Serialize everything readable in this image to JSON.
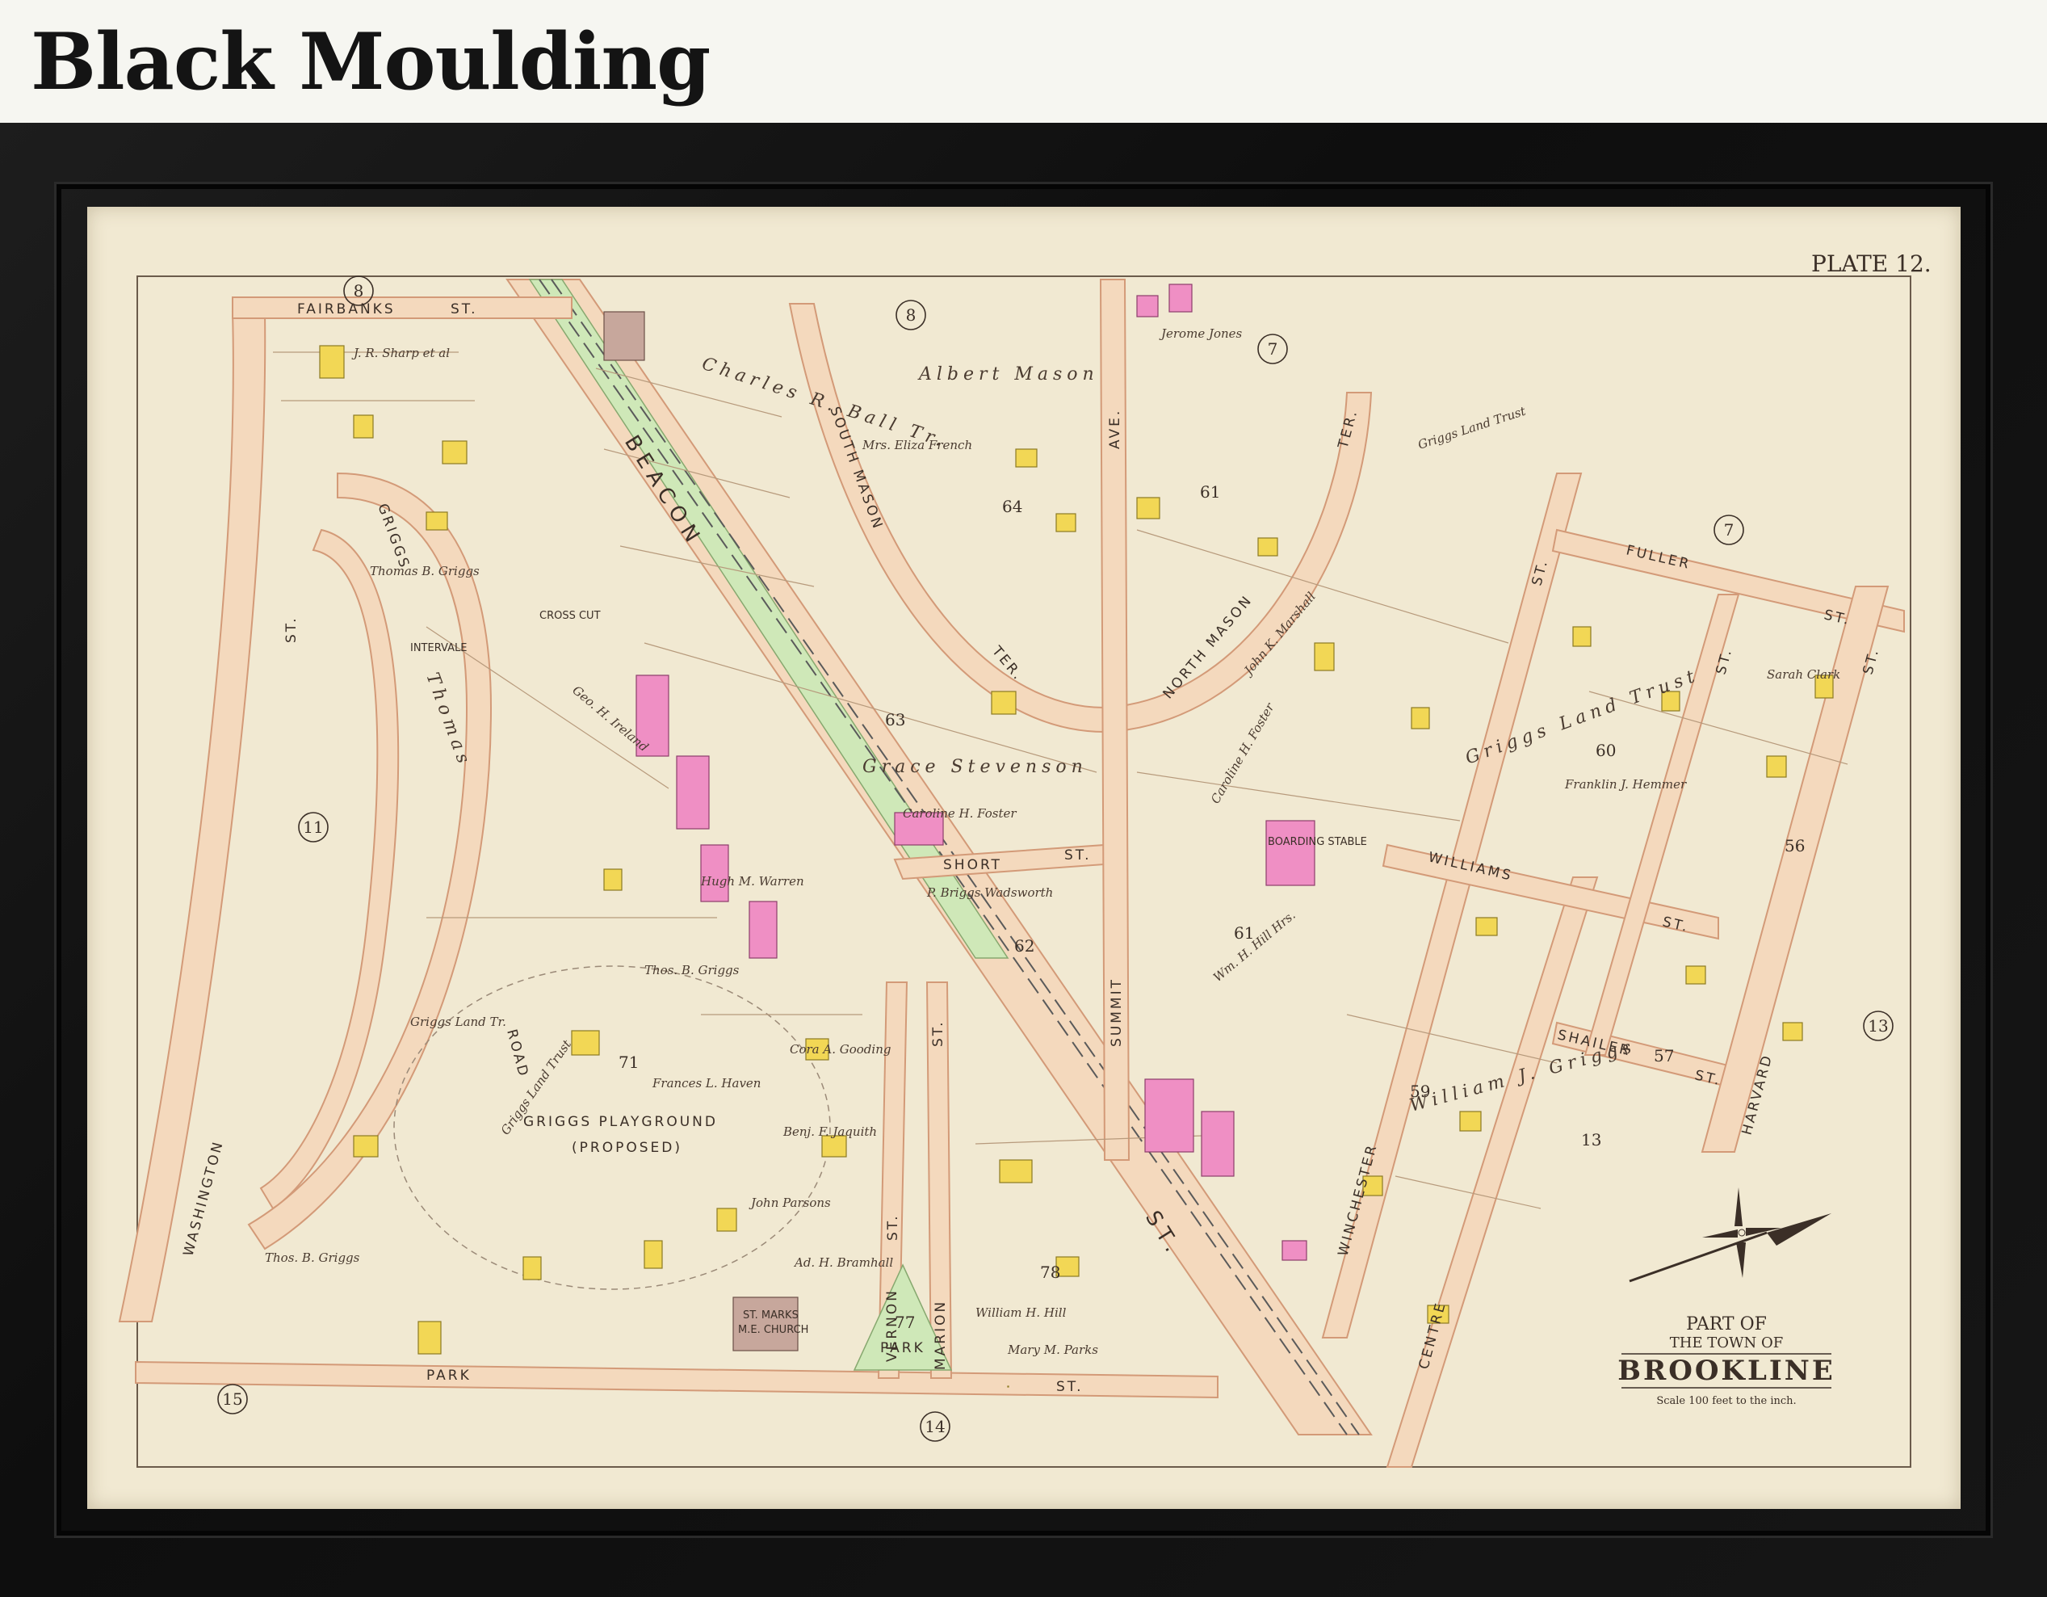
{
  "heading": "Black Moulding",
  "map": {
    "plate": "PLATE 12.",
    "title_line1": "PART OF",
    "title_line2": "THE TOWN OF",
    "title_line3": "BROOKLINE",
    "scale": "Scale 100 feet to the inch.",
    "ward_numbers": [
      "8",
      "8",
      "7",
      "7",
      "11",
      "15",
      "14",
      "13",
      "13"
    ],
    "streets": {
      "fairbanks": "FAIRBANKS",
      "st": "ST.",
      "beacon": "BEACON",
      "griggs": "GRIGGS",
      "road": "ROAD",
      "intervale": "INTERVALE",
      "cross_cut": "CROSS CUT",
      "washington": "WASHINGTON",
      "park": "PARK",
      "south_mason": "SOUTH MASON",
      "ter": "TER.",
      "north_mason": "NORTH MASON",
      "ave": "AVE.",
      "summit": "SUMMIT",
      "short": "SHORT",
      "fuller": "FULLER",
      "williams": "WILLIAMS",
      "shailer": "SHAILER",
      "harvard": "HARVARD",
      "winchester": "WINCHESTER",
      "centre": "CENTRE",
      "vernon": "VERNON",
      "marion": "MARION"
    },
    "places": {
      "playground": "GRIGGS PLAYGROUND",
      "proposed": "(PROPOSED)",
      "church_line1": "ST. MARKS",
      "church_line2": "M.E. CHURCH",
      "park_label": "PARK",
      "park_lot": "77",
      "boarding_stable": "BOARDING STABLE"
    },
    "lot_numbers": [
      "71",
      "63",
      "64",
      "61",
      "62",
      "60",
      "56",
      "57",
      "59",
      "78",
      "61"
    ],
    "owners": {
      "sharp": "J. R. Sharp et al",
      "thomas_griggs": "Thomas B. Griggs",
      "griggs_land_trust": "Griggs Land Trust",
      "thomas": "Thomas",
      "griggs_land_tr": "Griggs Land Tr.",
      "geo_ireland": "Geo. H. Ireland",
      "hugh_warren": "Hugh M. Warren",
      "thos_griggs": "Thos. B. Griggs",
      "frances_haven": "Frances L. Haven",
      "john_parsons": "John Parsons",
      "benj_jaquith": "Benj. F. Jaquith",
      "cora_gooding": "Cora A. Gooding",
      "ad_bramhall": "Ad. H. Bramhall",
      "thos_b_griggs2": "Thos. B. Griggs",
      "albert_mason": "Albert Mason",
      "charles_ball": "Charles R. Ball Tr.",
      "eliza_french": "Mrs. Eliza French",
      "grace_stevenson": "Grace Stevenson",
      "caroline_foster": "Caroline H. Foster",
      "p_griggs_wadsworth": "P. Briggs Wadsworth",
      "jerome_jones": "Jerome Jones",
      "john_marshall": "John K. Marshall",
      "griggs_land_trust2": "Griggs Land Trust",
      "caroline_foster2": "Caroline H. Foster",
      "franklin_hemmer": "Franklin J. Hemmer",
      "griggs_and_trust": "Griggs Land Trust",
      "william_griggs": "William J. Griggs",
      "sarah_clark": "Sarah Clark",
      "william_hill": "William H. Hill",
      "mary_parks": "Mary M. Parks",
      "wm_hill_hrs": "Wm. H. Hill Hrs."
    },
    "colors": {
      "paper": "#f1e9d2",
      "road": "#f4d9bd",
      "building_brick": "#f2d755",
      "building_pink": "#ef8fc4",
      "park_green": "#cfe8b8",
      "frame": "#141414"
    }
  }
}
